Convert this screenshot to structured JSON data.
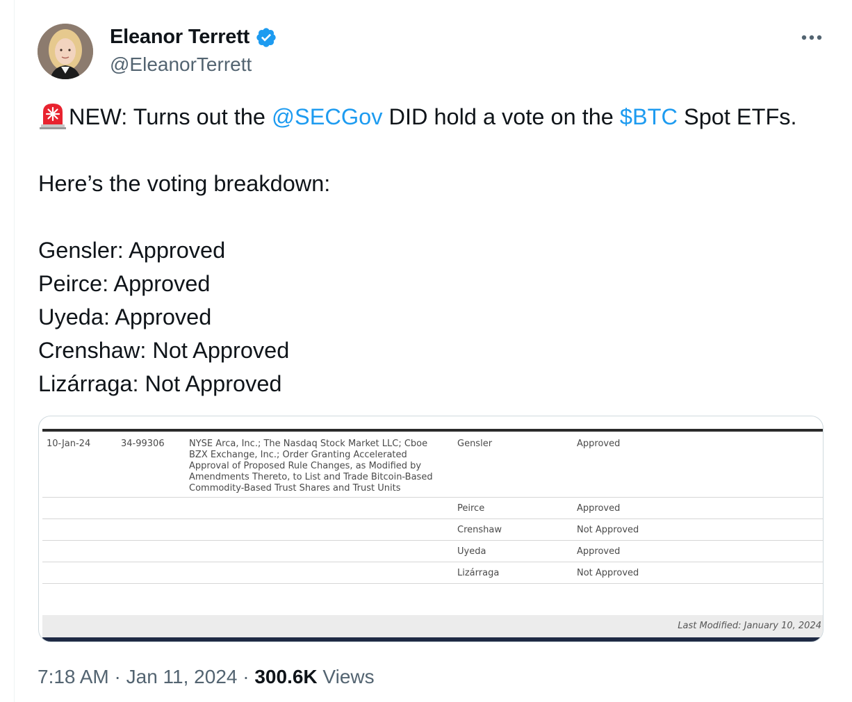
{
  "author": {
    "display_name": "Eleanor Terrett",
    "handle": "@EleanorTerrett",
    "verified_icon": "verified-badge-icon",
    "more_icon": "more-options-icon"
  },
  "tweet": {
    "line1": {
      "prefix": "NEW: Turns out the ",
      "mention": "@SECGov",
      "middle": " DID hold a vote on the ",
      "cashtag": "$BTC",
      "suffix": " Spot ETFs."
    },
    "line2": "Here’s the voting breakdown:",
    "votes": [
      "Gensler: Approved",
      "Peirce: Approved",
      "Uyeda: Approved",
      "Crenshaw: Not Approved",
      "Lizárraga: Not Approved"
    ]
  },
  "media": {
    "date": "10-Jan-24",
    "release_no": "34-99306",
    "description": "NYSE Arca, Inc.; The Nasdaq Stock Market LLC; Cboe BZX Exchange, Inc.; Order Granting Accelerated Approval of Proposed Rule Changes, as Modified by Amendments Thereto, to List and Trade Bitcoin-Based Commodity-Based Trust Shares and Trust Units",
    "rows": [
      {
        "name": "Gensler",
        "vote": "Approved"
      },
      {
        "name": "Peirce",
        "vote": "Approved"
      },
      {
        "name": "Crenshaw",
        "vote": "Not Approved"
      },
      {
        "name": "Uyeda",
        "vote": "Approved"
      },
      {
        "name": "Lizárraga",
        "vote": "Not Approved"
      }
    ],
    "last_modified": "Last Modified: January 10, 2024"
  },
  "meta": {
    "time": "7:18 AM",
    "sep1": " · ",
    "date": "Jan 11, 2024",
    "sep2": " · ",
    "views_count": "300.6K",
    "views_label": " Views"
  },
  "colors": {
    "link": "#1d9bf0",
    "secondary_text": "#536471",
    "primary_text": "#0f1419"
  }
}
